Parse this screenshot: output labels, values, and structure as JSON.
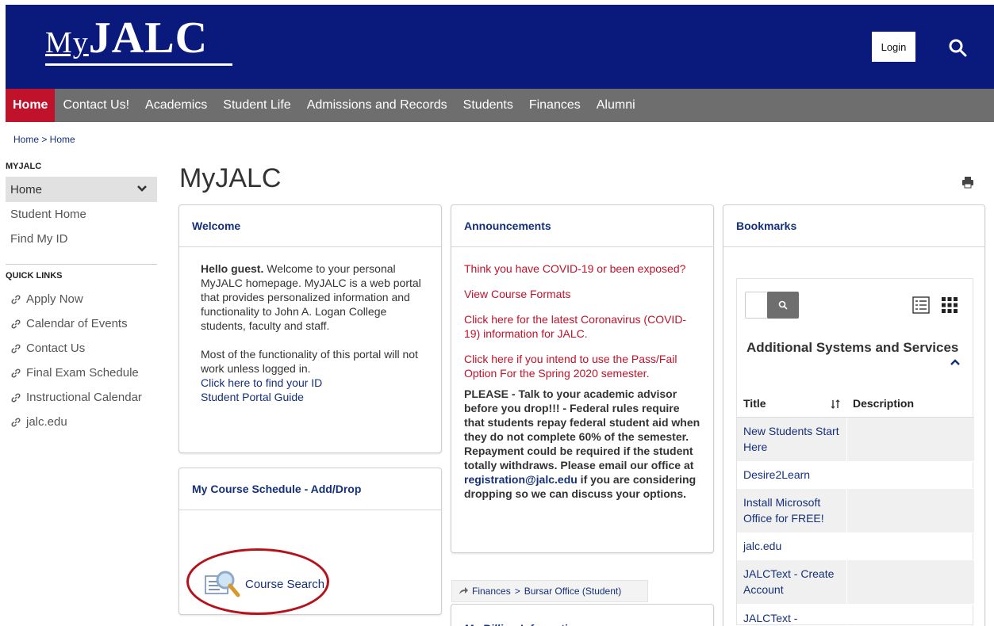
{
  "header": {
    "logo_my": "My",
    "logo_jalc": "JALC",
    "login_label": "Login"
  },
  "nav": {
    "items": [
      "Home",
      "Contact Us!",
      "Academics",
      "Student Life",
      "Admissions and Records",
      "Students",
      "Finances",
      "Alumni"
    ]
  },
  "breadcrumb": "Home > Home",
  "sidebar": {
    "section_title": "MYJALC",
    "selected": "Home",
    "links": [
      "Student Home",
      "Find My ID"
    ],
    "quick_links_title": "QUICK LINKS",
    "quick_links": [
      "Apply Now",
      "Calendar of Events",
      "Contact Us",
      "Final Exam Schedule",
      "Instructional Calendar",
      "jalc.edu"
    ]
  },
  "page_title": "MyJALC",
  "welcome": {
    "title": "Welcome",
    "greeting": "Hello guest.",
    "intro": " Welcome to your personal MyJALC homepage. MyJALC is a web portal that provides personalized information and functionality to John A. Logan College students, faculty and staff.",
    "note": "Most of the functionality of this portal will not work unless logged in.",
    "link_find_id": "Click here to find your ID",
    "link_guide": "Student Portal Guide"
  },
  "schedule": {
    "title": "My Course Schedule - Add/Drop",
    "course_search": "Course Search"
  },
  "announcements": {
    "title": "Announcements",
    "links": [
      "Think you have COVID-19 or been exposed?",
      "View Course Formats",
      "Click here for the latest Coronavirus (COVID-19) information for JALC.",
      "Click here if you intend to use the Pass/Fail Option For the Spring 2020 semester."
    ],
    "notice_pre": "PLEASE - Talk to your academic advisor before you drop!!! - Federal rules require that students repay federal student aid when they do not complete 60% of the semester. Repayment could be required if the student totally withdraws. Please email our office at ",
    "notice_email": "registration@jalc.edu",
    "notice_post": " if you are considering dropping so we can discuss your options."
  },
  "finances_crumb": {
    "a": "Finances",
    "sep": ">",
    "b": "Bursar Office (Student)"
  },
  "billing": {
    "title": "My Billing Information"
  },
  "bookmarks": {
    "title": "Bookmarks",
    "section": "Additional Systems and Services",
    "col_title": "Title",
    "col_desc": "Description",
    "rows": [
      "New Students Start Here",
      "Desire2Learn",
      "Install Microsoft Office for FREE!",
      "jalc.edu",
      "JALCText - Create Account",
      "JALCText - Manage"
    ]
  },
  "colors": {
    "header_bg": "#0a1a7c",
    "nav_bg": "#6e6e6e",
    "nav_active": "#c0122a",
    "link": "#14307a",
    "alert": "#c0122a"
  }
}
